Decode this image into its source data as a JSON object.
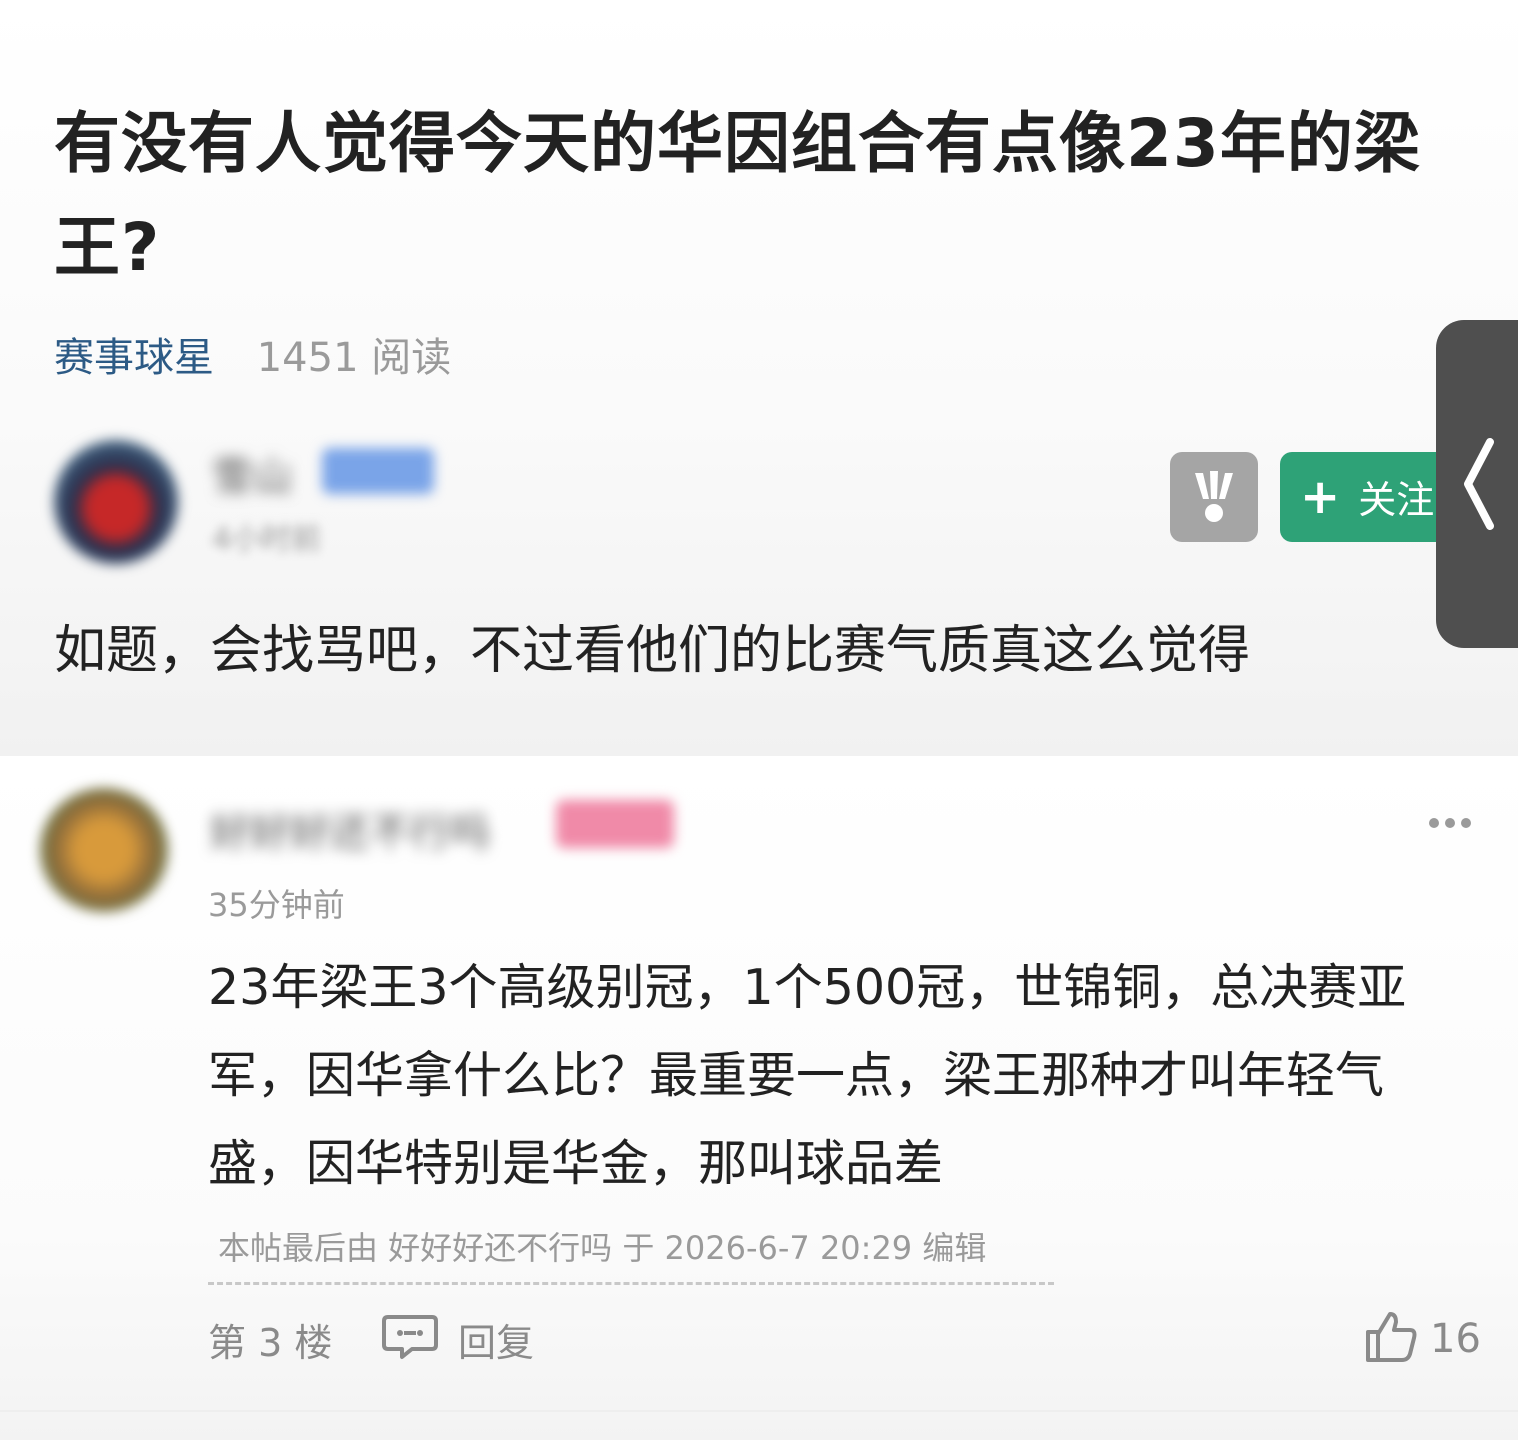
{
  "post": {
    "title": "有没有人觉得今天的华因组合有点像23年的梁王?",
    "forum": "赛事球星",
    "read_count": "1451 阅读",
    "author_name": "雪山",
    "author_badge": "楼主",
    "author_time": "4小时前",
    "follow_label": "关注",
    "body": "如题，会找骂吧，不过看他们的比赛气质真这么觉得"
  },
  "reply": {
    "author_name": "好好好还不行吗",
    "author_badge": "粉丝",
    "time": "35分钟前",
    "body": "23年梁王3个高级别冠，1个500冠，世锦铜，总决赛亚军，因华拿什么比？最重要一点，梁王那种才叫年轻气盛，因华特别是华金，那叫球品差",
    "edit_note": "本帖最后由 好好好还不行吗 于 2026-6-7 20:29 编辑",
    "floor": "第 3 楼",
    "reply_label": "回复",
    "likes": "16"
  },
  "colors": {
    "forum_link": "#2c5a85",
    "follow_button": "#2ea277",
    "muted_text": "#9a9a9a"
  },
  "icons": [
    "badminton-shuttle-icon",
    "plus-icon",
    "chevron-left-icon",
    "more-dots-icon",
    "comment-icon",
    "thumbs-up-icon"
  ]
}
